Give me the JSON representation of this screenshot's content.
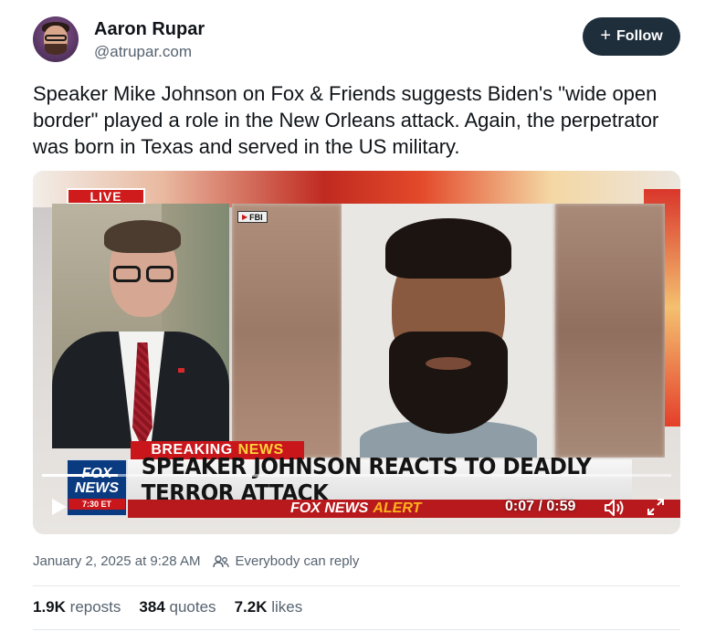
{
  "author": {
    "name": "Aaron Rupar",
    "handle": "@atrupar.com"
  },
  "follow_button": {
    "icon": "plus-icon",
    "label": "Follow"
  },
  "post": {
    "text": "Speaker Mike Johnson on Fox & Friends suggests Biden's \"wide open border\" played a role in the New Orleans attack. Again, the perpetrator was born in Texas and served in the US military."
  },
  "video": {
    "live_label": "LIVE",
    "fbi_tag": "FBI",
    "breaking_prefix": "BREAKING",
    "breaking_suffix": "NEWS",
    "headline": "SPEAKER JOHNSON REACTS TO DEADLY TERROR ATTACK",
    "ticker_brand": "FOX NEWS",
    "ticker_alert": "ALERT",
    "logo_line1": "FOX",
    "logo_line2": "NEWS",
    "logo_time": "7:30 ET",
    "time_display": "0:07 / 0:59",
    "progress": 0.12
  },
  "meta": {
    "date": "January 2, 2025 at 9:28 AM",
    "reply_setting": "Everybody can reply",
    "reply_icon": "people-icon"
  },
  "stats": {
    "reposts_count": "1.9K",
    "reposts_label": "reposts",
    "quotes_count": "384",
    "quotes_label": "quotes",
    "likes_count": "7.2K",
    "likes_label": "likes"
  }
}
